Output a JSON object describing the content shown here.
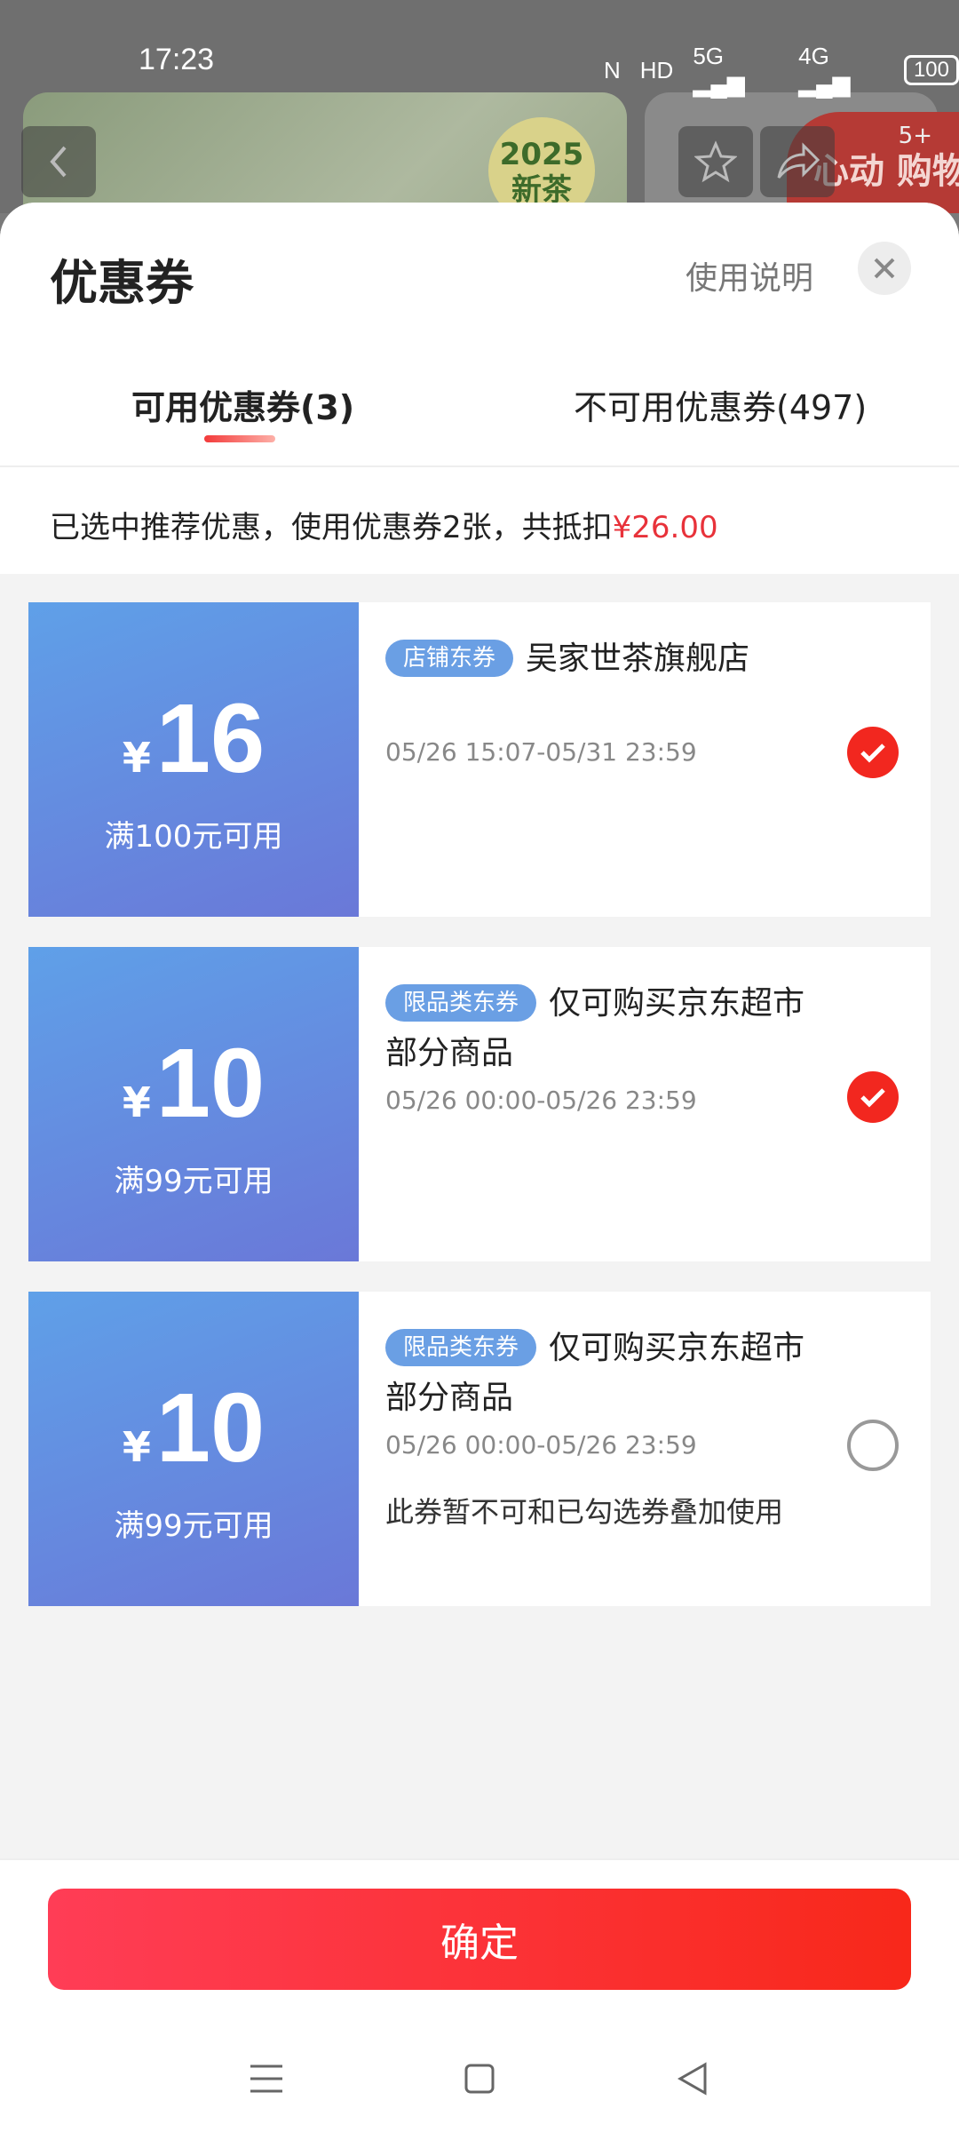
{
  "status_bar": {
    "time": "17:23",
    "network_5g": "5G",
    "network_4g": "4G",
    "hd": "HD",
    "battery": "100"
  },
  "background": {
    "badge_text": "2025 新茶",
    "promo_text": "心动 购物车",
    "cart_count": "5+"
  },
  "sheet": {
    "title": "优惠券",
    "help_label": "使用说明",
    "tabs": [
      {
        "label": "可用优惠券(3)",
        "active": true
      },
      {
        "label": "不可用优惠券(497)",
        "active": false
      }
    ],
    "summary_prefix": "已选中推荐优惠，使用优惠券2张，共抵扣",
    "summary_amount": "¥26.00"
  },
  "coupons": [
    {
      "currency": "¥",
      "value": "16",
      "threshold": "满100元可用",
      "tag": "店铺东券",
      "title": "吴家世茶旗舰店",
      "validity": "05/26 15:07-05/31 23:59",
      "note": "",
      "selected": true
    },
    {
      "currency": "¥",
      "value": "10",
      "threshold": "满99元可用",
      "tag": "限品类东券",
      "title": "仅可购买京东超市部分商品",
      "validity": "05/26 00:00-05/26 23:59",
      "note": "",
      "selected": true
    },
    {
      "currency": "¥",
      "value": "10",
      "threshold": "满99元可用",
      "tag": "限品类东券",
      "title": "仅可购买京东超市部分商品",
      "validity": "05/26 00:00-05/26 23:59",
      "note": "此券暂不可和已勾选券叠加使用",
      "selected": false
    }
  ],
  "footer": {
    "confirm_label": "确定"
  },
  "colors": {
    "accent_red": "#f2271f",
    "coupon_blue": "#5fa0e8",
    "tag_blue": "#6a9fe4"
  }
}
